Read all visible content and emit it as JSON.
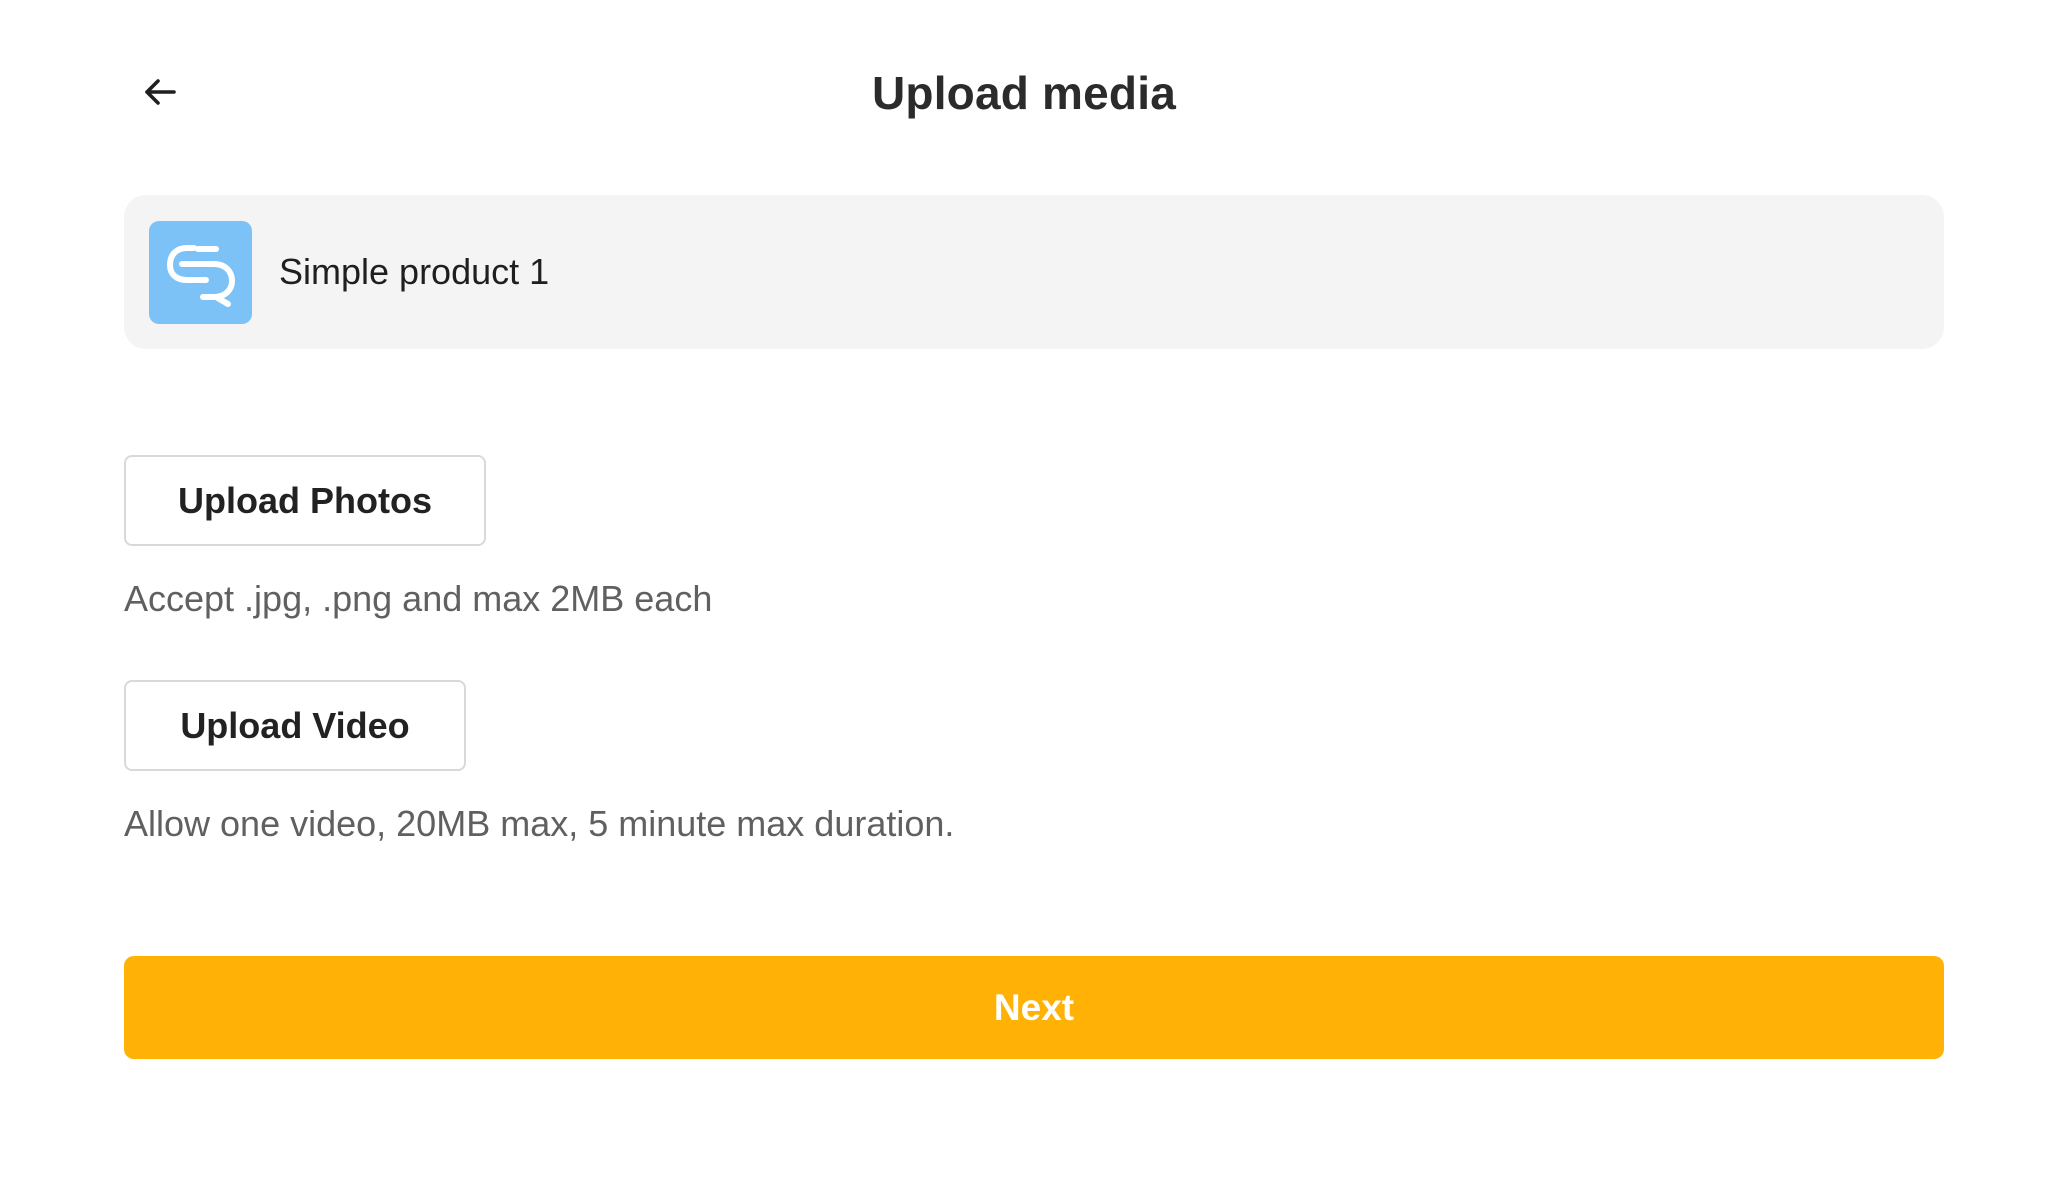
{
  "header": {
    "title": "Upload media",
    "back_icon": "arrow-left-icon"
  },
  "product": {
    "name": "Simple product 1",
    "thumbnail_icon": "product-logo-icon",
    "thumbnail_color": "#7cc2f7"
  },
  "upload_photos": {
    "label": "Upload Photos",
    "help": "Accept .jpg, .png and max 2MB each"
  },
  "upload_video": {
    "label": "Upload Video",
    "help": "Allow one video, 20MB max, 5 minute max duration."
  },
  "next": {
    "label": "Next",
    "color": "#ffb105"
  }
}
